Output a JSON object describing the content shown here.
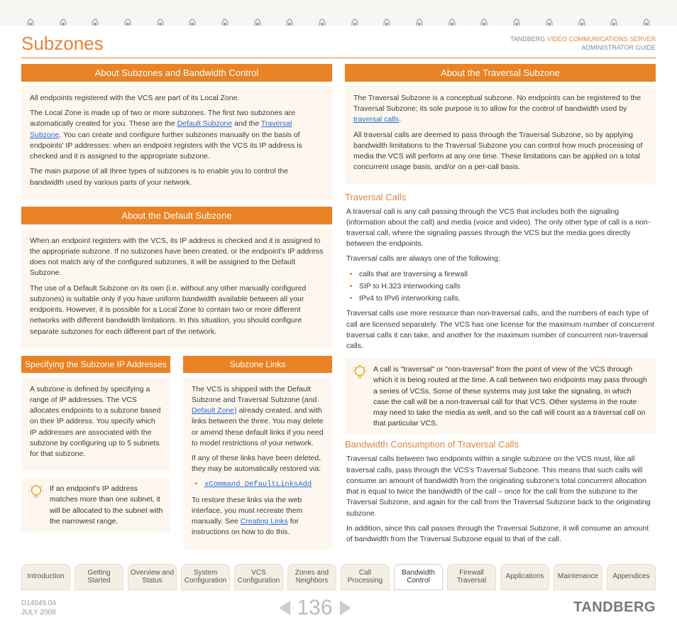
{
  "header": {
    "title": "Subzones",
    "right_line1_pre": "TANDBERG ",
    "right_line1_orange": "VIDEO COMMUNICATIONS SERVER",
    "right_line2": "ADMINISTRATOR GUIDE"
  },
  "left": {
    "bar1": "About Subzones and Bandwidth Control",
    "p1": "All endpoints registered with the VCS are part of its Local Zone.",
    "p2a": "The Local Zone is made up of two or more subzones.  The first two subzones are automatically created for you.  These are the ",
    "p2_link1": "Default Subzone",
    "p2b": " and the ",
    "p2_link2": "Traversal Subzone",
    "p2c": ".  You can create and configure further subzones manually on the basis of endpoints' IP addresses: when an endpoint registers with the VCS its IP address is checked and it is assigned to the appropriate subzone.",
    "p3": "The main purpose of all three types of subzones is to enable you to control the bandwidth used by various parts of your network.",
    "bar2": "About the Default Subzone",
    "p4": "When an endpoint registers with the VCS, its IP address is checked and it is assigned to the appropriate subzone.  If no subzones have been created, or the endpoint's IP address does not match any of the configured subzones, it will be assigned to the Default Subzone.",
    "p5": "The use of a Default Subzone on its own (i.e. without any other manually configured subzones) is suitable only if you have uniform bandwidth available between all your endpoints. However, it is possible for a Local Zone to contain two or more different networks with different bandwidth limitations.  In this situation, you should configure separate subzones for each different part of the network.",
    "sub_left": {
      "bar": "Specifying the Subzone IP Addresses",
      "p1": "A subzone is defined by specifying a range of IP addresses.  The VCS allocates endpoints to a subzone based on their IP address.  You specify which IP addresses are associated with the subzone by configuring up to 5 subnets for that subzone.",
      "tip": "If an endpoint's IP address matches more than one subnet, it will be allocated to the subnet with the narrowest range."
    },
    "sub_right": {
      "bar": "Subzone Links",
      "p1a": "The VCS is shipped with the Default Subzone and Traversal Subzone (and ",
      "p1_link": "Default Zone)",
      "p1b": " already created, and with links between the three. You may delete or amend these default links if you need to model restrictions of your network.",
      "p2": "If any of these links have been deleted, they may be automatically restored via:",
      "cmd": "xCommand DefaultLinksAdd",
      "p3a": "To restore these links via the web interface, you must recreate them manually.  See ",
      "p3_link": "Creating Links",
      "p3b": " for instructions on how to do this."
    }
  },
  "right": {
    "bar1": "About the Traversal Subzone",
    "p1a": "The Traversal Subzone is a conceptual subzone. No endpoints can be registered to the Traversal Subzone; its sole purpose is to allow for the control of bandwidth used by ",
    "p1_link": "traversal calls",
    "p1b": ".",
    "p2": "All traversal calls are deemed to pass through the Traversal Subzone, so by applying bandwidth limitations to the Traversal Subzone you can control how much processing of media the VCS will perform at any one time.  These limitations can be applied on a total concurrent usage basis, and/or on a per-call basis.",
    "h1": "Traversal Calls",
    "p3": "A traversal call is any call passing through the VCS that includes both the signaling (information about the call) and media (voice and video).  The only other type of call is a non-traversal call, where the signaling passes through the VCS but the media goes directly between the endpoints.",
    "p4": "Traversal calls are always one of the following:",
    "li1": "calls that are traversing a firewall",
    "li2": "SIP to H.323 interworking calls",
    "li3": "IPv4 to IPv6 interworking calls.",
    "p5": "Traversal calls use more resource than non-traversal calls, and the numbers of each type of call are licensed separately.  The VCS has one license for the maximum number of concurrent traversal calls it can take, and another for the maximum number of concurrent non-traversal calls.",
    "tip": "A call is \"traversal\" or \"non-traversal\" from the point of view of the VCS through which it is being routed at the time.  A call between two endpoints may pass through a series of VCSs. Some of these systems may just take the signaling, in which case the call will be a non-traversal call for that VCS.  Other systems in the route may need to take the media as well, and so the call will count as a traversal call on that particular VCS.",
    "h2": "Bandwidth Consumption of Traversal Calls",
    "p6": "Traversal calls between two endpoints within a single subzone on the VCS must, like all traversal calls, pass through the VCS's Traversal Subzone.  This means that such calls will consume an amount of bandwidth from the originating subzone's total concurrent allocation that is equal to twice the bandwidth of the call – once for the call from the subzone to the Traversal Subzone, and again for the call from the Traversal Subzone back to the originating subzone.",
    "p7": "In addition, since this call passes through the Traversal Subzone, it will consume an amount of bandwidth from the Traversal Subzone equal to that of the call."
  },
  "tabs": [
    "Introduction",
    "Getting Started",
    "Overview and Status",
    "System Configuration",
    "VCS Configuration",
    "Zones and Neighbors",
    "Call Processing",
    "Bandwidth Control",
    "Firewall Traversal",
    "Applications",
    "Maintenance",
    "Appendices"
  ],
  "active_tab_index": 7,
  "footer": {
    "doc_id": "D14049.04",
    "date": "JULY 2008",
    "page": "136",
    "brand": "TANDBERG"
  }
}
